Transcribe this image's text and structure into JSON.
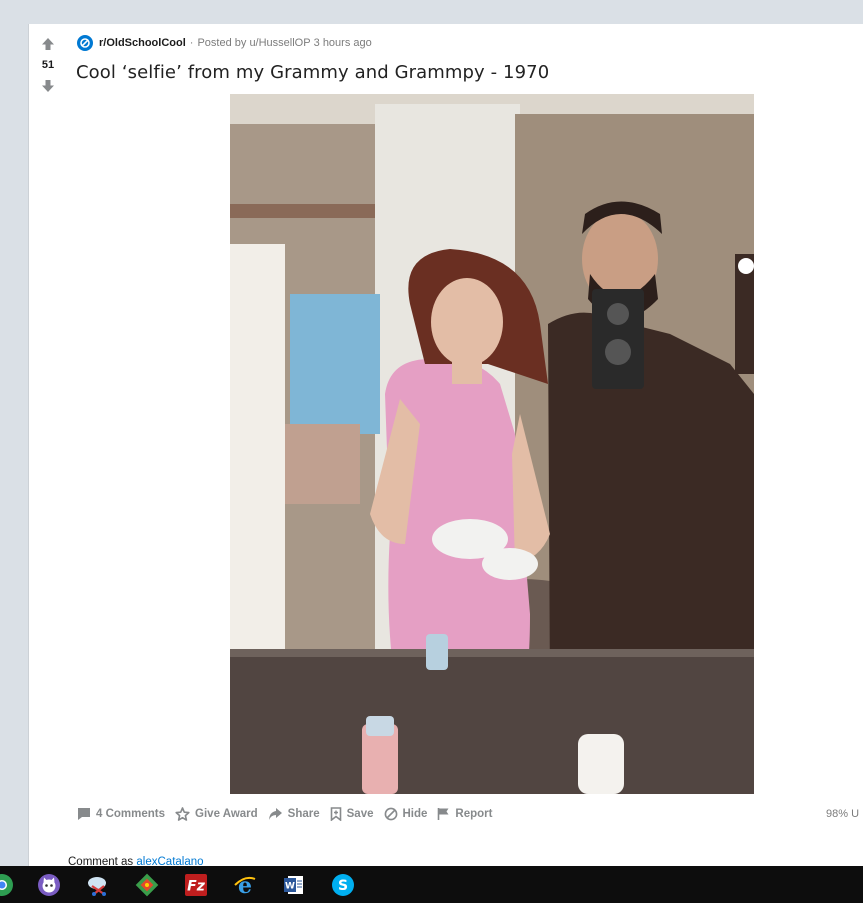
{
  "post": {
    "vote_count": "51",
    "subreddit": "r/OldSchoolCool",
    "separator": "·",
    "posted_by_prefix": "Posted by",
    "author": "u/HussellOP",
    "time": "3 hours ago",
    "title": "Cool ‘selfie’ from my Grammy and Grammpy - 1970",
    "upvote_ratio": "98% U"
  },
  "actions": [
    {
      "icon": "comment-icon",
      "label": "4 Comments"
    },
    {
      "icon": "award-icon",
      "label": "Give Award"
    },
    {
      "icon": "share-icon",
      "label": "Share"
    },
    {
      "icon": "bookmark-icon",
      "label": "Save"
    },
    {
      "icon": "hide-icon",
      "label": "Hide"
    },
    {
      "icon": "flag-icon",
      "label": "Report"
    }
  ],
  "comment_box": {
    "prefix": "Comment as",
    "username": "alexCatalano"
  },
  "taskbar": {
    "icons": [
      "chrome-icon",
      "cat-app-icon",
      "snipping-tool-icon",
      "git-icon",
      "filezilla-icon",
      "internet-explorer-icon",
      "word-icon",
      "skype-icon"
    ]
  },
  "colors": {
    "page_bg": "#dae0e6",
    "card_bg": "#ffffff",
    "link": "#0079d3",
    "muted": "#878a8c",
    "taskbar": "#0d0d0d"
  }
}
